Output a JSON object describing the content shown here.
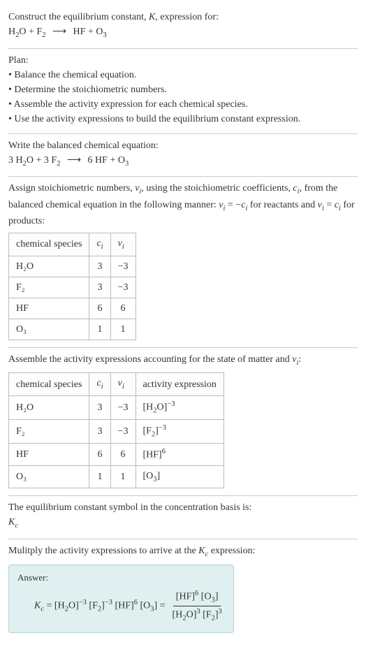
{
  "intro": {
    "line1": "Construct the equilibrium constant, ",
    "K": "K",
    "line1b": ", expression for:"
  },
  "reaction_unbalanced": {
    "lhs1": "H",
    "lhs1sub": "2",
    "lhs1b": "O",
    "plus1": "+",
    "lhs2": "F",
    "lhs2sub": "2",
    "arrow": "⟶",
    "rhs1": "HF",
    "plus2": "+",
    "rhs2": "O",
    "rhs2sub": "3"
  },
  "plan": {
    "title": "Plan:",
    "b1": "• Balance the chemical equation.",
    "b2": "• Determine the stoichiometric numbers.",
    "b3": "• Assemble the activity expression for each chemical species.",
    "b4": "• Use the activity expressions to build the equilibrium constant expression."
  },
  "balanced_title": "Write the balanced chemical equation:",
  "reaction_balanced": {
    "c1": "3 ",
    "s1": "H",
    "s1sub": "2",
    "s1b": "O",
    "plus1": "+",
    "c2": "3 ",
    "s2": "F",
    "s2sub": "2",
    "arrow": "⟶",
    "c3": "6 ",
    "s3": "HF",
    "plus2": "+",
    "s4": "O",
    "s4sub": "3"
  },
  "assign": {
    "p1": "Assign stoichiometric numbers, ",
    "nu": "ν",
    "nui": "i",
    "p2": ", using the stoichiometric coefficients, ",
    "c": "c",
    "ci": "i",
    "p3": ", from the balanced chemical equation in the following manner: ",
    "eq1a": "ν",
    "eq1ai": "i",
    "eq1b": " = −",
    "eq1c": "c",
    "eq1ci": "i",
    "p4": " for reactants and ",
    "eq2a": "ν",
    "eq2ai": "i",
    "eq2b": " = ",
    "eq2c": "c",
    "eq2ci": "i",
    "p5": " for products:"
  },
  "table1": {
    "h1": "chemical species",
    "h2c": "c",
    "h2i": "i",
    "h3c": "ν",
    "h3i": "i",
    "rows": [
      {
        "sp": "H₂O",
        "c": "3",
        "v": "−3"
      },
      {
        "sp": "F₂",
        "c": "3",
        "v": "−3"
      },
      {
        "sp": "HF",
        "c": "6",
        "v": "6"
      },
      {
        "sp": "O₃",
        "c": "1",
        "v": "1"
      }
    ]
  },
  "assemble": {
    "p1": "Assemble the activity expressions accounting for the state of matter and ",
    "nu": "ν",
    "nui": "i",
    "p2": ":"
  },
  "table2": {
    "h1": "chemical species",
    "h2c": "c",
    "h2i": "i",
    "h3c": "ν",
    "h3i": "i",
    "h4": "activity expression",
    "rows": [
      {
        "sp": "H₂O",
        "c": "3",
        "v": "−3",
        "ab": "[H",
        "asub": "2",
        "ab2": "O]",
        "aexp": "−3"
      },
      {
        "sp": "F₂",
        "c": "3",
        "v": "−3",
        "ab": "[F",
        "asub": "2",
        "ab2": "]",
        "aexp": "−3"
      },
      {
        "sp": "HF",
        "c": "6",
        "v": "6",
        "ab": "[HF]",
        "asub": "",
        "ab2": "",
        "aexp": "6"
      },
      {
        "sp": "O₃",
        "c": "1",
        "v": "1",
        "ab": "[O",
        "asub": "3",
        "ab2": "]",
        "aexp": ""
      }
    ]
  },
  "kc_symbol": {
    "line": "The equilibrium constant symbol in the concentration basis is:",
    "K": "K",
    "Ksub": "c"
  },
  "multiply": {
    "p1": "Mulitply the activity expressions to arrive at the ",
    "K": "K",
    "Ksub": "c",
    "p2": " expression:"
  },
  "answer": {
    "label": "Answer:",
    "K": "K",
    "Ksub": "c",
    "eq": " = ",
    "t1": "[H",
    "t1sub": "2",
    "t1b": "O]",
    "t1exp": "−3",
    "t2": "[F",
    "t2sub": "2",
    "t2b": "]",
    "t2exp": "−3",
    "t3": "[HF]",
    "t3exp": "6",
    "t4": "[O",
    "t4sub": "3",
    "t4b": "]",
    "eq2": " = ",
    "num1": "[HF]",
    "num1exp": "6",
    "num2": "[O",
    "num2sub": "3",
    "num2b": "]",
    "den1": "[H",
    "den1sub": "2",
    "den1b": "O]",
    "den1exp": "3",
    "den2": "[F",
    "den2sub": "2",
    "den2b": "]",
    "den2exp": "3"
  }
}
